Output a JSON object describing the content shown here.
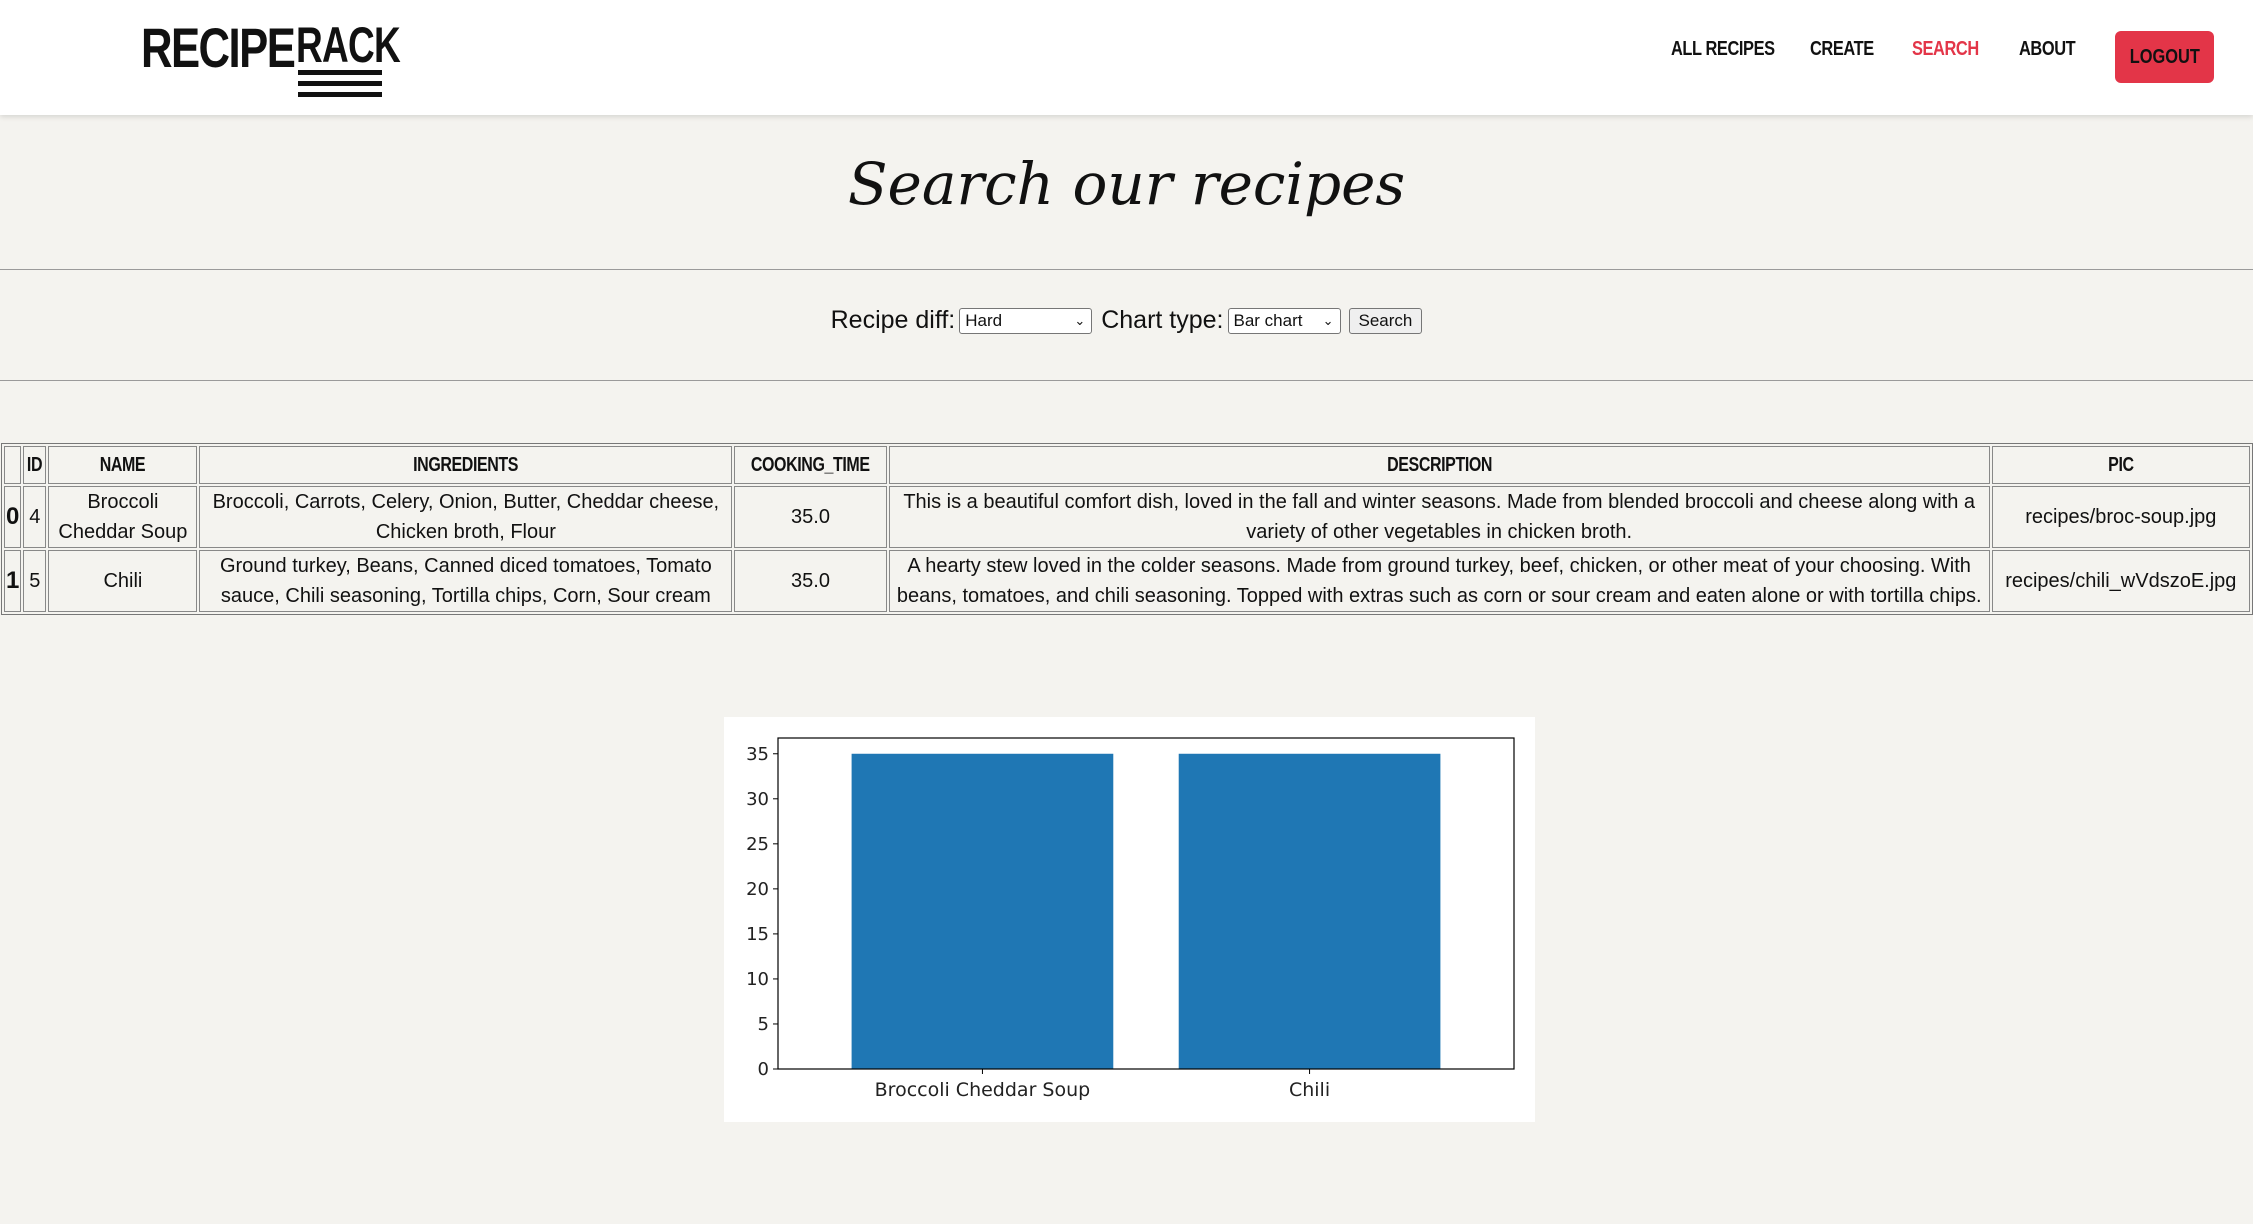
{
  "header": {
    "logo_word1": "RECIPE",
    "logo_word2": "RACK",
    "nav": [
      "ALL RECIPES",
      "CREATE",
      "SEARCH",
      "ABOUT"
    ],
    "active_nav": "SEARCH",
    "logout_label": "LOGOUT",
    "accent_color": "#e33548"
  },
  "page_title": "Search our recipes",
  "form": {
    "difficulty_label": "Recipe diff:",
    "difficulty_value": "Hard",
    "chart_type_label": "Chart type:",
    "chart_type_value": "Bar chart",
    "search_button": "Search"
  },
  "table": {
    "columns": [
      "ID",
      "NAME",
      "INGREDIENTS",
      "COOKING_TIME",
      "DESCRIPTION",
      "PIC"
    ],
    "rows": [
      {
        "index": "0",
        "id": "4",
        "name": "Broccoli Cheddar Soup",
        "ingredients": "Broccoli, Carrots, Celery, Onion, Butter, Cheddar cheese, Chicken broth, Flour",
        "cooking_time": "35.0",
        "description": "This is a beautiful comfort dish, loved in the fall and winter seasons. Made from blended broccoli and cheese along with a variety of other vegetables in chicken broth.",
        "pic": "recipes/broc-soup.jpg"
      },
      {
        "index": "1",
        "id": "5",
        "name": "Chili",
        "ingredients": "Ground turkey, Beans, Canned diced tomatoes, Tomato sauce, Chili seasoning, Tortilla chips, Corn, Sour cream",
        "cooking_time": "35.0",
        "description": "A hearty stew loved in the colder seasons. Made from ground turkey, beef, chicken, or other meat of your choosing. With beans, tomatoes, and chili seasoning. Topped with extras such as corn or sour cream and eaten alone or with tortilla chips.",
        "pic": "recipes/chili_wVdszoE.jpg"
      }
    ]
  },
  "chart_data": {
    "type": "bar",
    "categories": [
      "Broccoli Cheddar Soup",
      "Chili"
    ],
    "values": [
      35,
      35
    ],
    "title": "",
    "xlabel": "",
    "ylabel": "",
    "ylim": [
      0,
      36.75
    ],
    "yticks": [
      0,
      5,
      10,
      15,
      20,
      25,
      30,
      35
    ],
    "bar_color": "#1f77b4",
    "grid": false,
    "legend": "none"
  }
}
